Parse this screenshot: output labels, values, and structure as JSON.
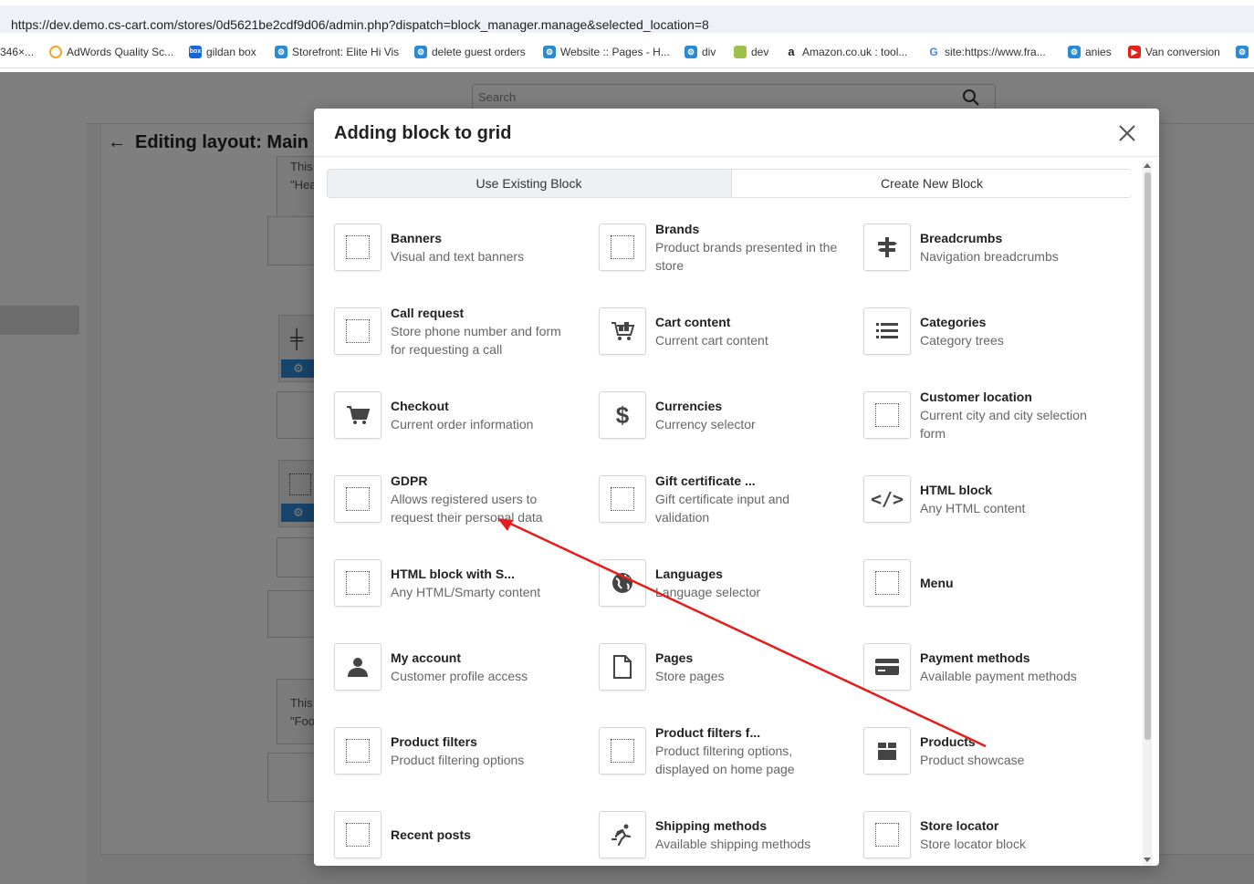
{
  "browser": {
    "url": "https://dev.demo.cs-cart.com/stores/0d5621be2cdf9d06/admin.php?dispatch=block_manager.manage&selected_location=8",
    "bookmarks": [
      {
        "label": "346×...",
        "icon": "none"
      },
      {
        "label": "AdWords Quality Sc...",
        "icon": "circle-icon",
        "color": "#f5a623"
      },
      {
        "label": "gildan box",
        "icon": "box-icon",
        "color": "#1a66d2"
      },
      {
        "label": "Storefront: Elite Hi Vis",
        "icon": "cscart-icon",
        "color": "#2b8ad6"
      },
      {
        "label": "delete guest orders",
        "icon": "cscart-icon",
        "color": "#2b8ad6"
      },
      {
        "label": "Website :: Pages - H...",
        "icon": "cscart-icon",
        "color": "#2b8ad6"
      },
      {
        "label": "div",
        "icon": "cscart-icon",
        "color": "#2b8ad6"
      },
      {
        "label": "dev",
        "icon": "bookmark-icon",
        "color": "#9cc14a"
      },
      {
        "label": "Amazon.co.uk : tool...",
        "icon": "amazon-icon",
        "color": "#222"
      },
      {
        "label": "site:https://www.fra...",
        "icon": "google-icon",
        "color": "#4285f4"
      },
      {
        "label": "anies",
        "icon": "cscart-icon",
        "color": "#2b8ad6"
      },
      {
        "label": "Van conversion",
        "icon": "youtube-icon",
        "color": "#e62117"
      }
    ]
  },
  "admin": {
    "search_placeholder": "Search",
    "page_title": "Editing layout: Main",
    "bg_text_1a": "This",
    "bg_text_1b": "\"Hea",
    "bg_text_2a": "This",
    "bg_text_2b": "\"Foo"
  },
  "modal": {
    "title": "Adding block to grid",
    "tabs": [
      "Use Existing Block",
      "Create New Block"
    ],
    "blocks": [
      {
        "name": "Banners",
        "desc": "Visual and text banners",
        "icon": "dotted-square-icon"
      },
      {
        "name": "Brands",
        "desc": "Product brands presented in the store",
        "icon": "dotted-square-icon"
      },
      {
        "name": "Breadcrumbs",
        "desc": "Navigation breadcrumbs",
        "icon": "signpost-icon"
      },
      {
        "name": "Call request",
        "desc": "Store phone number and form for requesting a call",
        "icon": "dotted-square-icon"
      },
      {
        "name": "Cart content",
        "desc": "Current cart content",
        "icon": "cart-full-icon"
      },
      {
        "name": "Categories",
        "desc": "Category trees",
        "icon": "list-icon"
      },
      {
        "name": "Checkout",
        "desc": "Current order information",
        "icon": "cart-icon"
      },
      {
        "name": "Currencies",
        "desc": "Currency selector",
        "icon": "dollar-icon"
      },
      {
        "name": "Customer location",
        "desc": "Current city and city selection form",
        "icon": "dotted-square-icon"
      },
      {
        "name": "GDPR",
        "desc": "Allows registered users to request their personal data",
        "icon": "dotted-square-icon"
      },
      {
        "name": "Gift certificate ...",
        "desc": "Gift certificate input and validation",
        "icon": "dotted-square-icon"
      },
      {
        "name": "HTML block",
        "desc": "Any HTML content",
        "icon": "code-icon"
      },
      {
        "name": "HTML block with S...",
        "desc": "Any HTML/Smarty content",
        "icon": "dotted-square-icon"
      },
      {
        "name": "Languages",
        "desc": "Language selector",
        "icon": "globe-icon"
      },
      {
        "name": "Menu",
        "desc": "",
        "icon": "dotted-square-icon"
      },
      {
        "name": "My account",
        "desc": "Customer profile access",
        "icon": "user-icon"
      },
      {
        "name": "Pages",
        "desc": "Store pages",
        "icon": "page-icon"
      },
      {
        "name": "Payment methods",
        "desc": "Available payment methods",
        "icon": "credit-card-icon"
      },
      {
        "name": "Product filters",
        "desc": "Product filtering options",
        "icon": "dotted-square-icon"
      },
      {
        "name": "Product filters f...",
        "desc": "Product filtering options, displayed on home page",
        "icon": "dotted-square-icon"
      },
      {
        "name": "Products",
        "desc": "Product showcase",
        "icon": "box-open-icon"
      },
      {
        "name": "Recent posts",
        "desc": "",
        "icon": "dotted-square-icon"
      },
      {
        "name": "Shipping methods",
        "desc": "Available shipping methods",
        "icon": "runner-icon"
      },
      {
        "name": "Store locator",
        "desc": "Store locator block",
        "icon": "dotted-square-icon"
      }
    ]
  },
  "annotation": {
    "color": "#e51c1c"
  }
}
